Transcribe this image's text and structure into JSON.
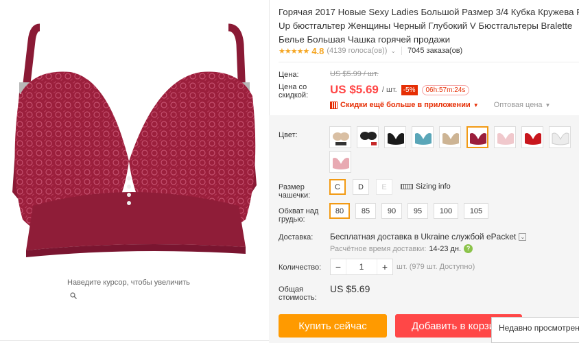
{
  "gallery": {
    "zoom_hint": "Наведите курсор, чтобы увеличить",
    "product_color": "#9b1f3c"
  },
  "product": {
    "title_lines": [
      "Горячая 2017 Новые Sexy Ladies Большой Размер 3/4 Кубка Кружева Р",
      "Up бюстгальтер Женщины Черный Глубокий V Бюстгальтеры Bralette",
      "Белье Большая Чашка горячей продажи"
    ],
    "stars": "★★★★★",
    "rating": "4.8",
    "votes": "(4139 голоса(ов))",
    "orders": "7045 заказа(ов)"
  },
  "price": {
    "label": "Цена:",
    "old": "US $5.99 / шт.",
    "sale_label_1": "Цена со",
    "sale_label_2": "скидкой:",
    "current": "US $5.69",
    "unit": "/ шт.",
    "discount": "-5%",
    "timer": "06h:57m:24s",
    "app_deal": "Скидки ещё больше в приложении",
    "wholesale": "Оптовая цена"
  },
  "options": {
    "color_label": "Цвет:",
    "colors": [
      "beige-set",
      "black-set",
      "black",
      "teal",
      "nude",
      "wine",
      "pink",
      "red",
      "white",
      "light-pink"
    ],
    "cup_label_1": "Размер",
    "cup_label_2": "чашечки:",
    "cups": [
      "C",
      "D",
      "E"
    ],
    "sizing_info": "Sizing info",
    "band_label_1": "Обхват над",
    "band_label_2": "грудью:",
    "bands": [
      "80",
      "85",
      "90",
      "95",
      "100",
      "105"
    ]
  },
  "shipping": {
    "label": "Доставка:",
    "line1": "Бесплатная доставка в Ukraine службой ePacket",
    "estimate_label": "Расчётное время доставки:",
    "estimate_days": "14-23 дн."
  },
  "quantity": {
    "label": "Количество:",
    "value": "1",
    "note": "шт. (979 шт. Доступно)"
  },
  "total": {
    "label_1": "Общая",
    "label_2": "стоимость:",
    "value": "US $5.69"
  },
  "actions": {
    "buy_now": "Купить сейчас",
    "add_to_cart": "Добавить в корзину"
  },
  "recently_viewed": "Недавно просмотренные"
}
